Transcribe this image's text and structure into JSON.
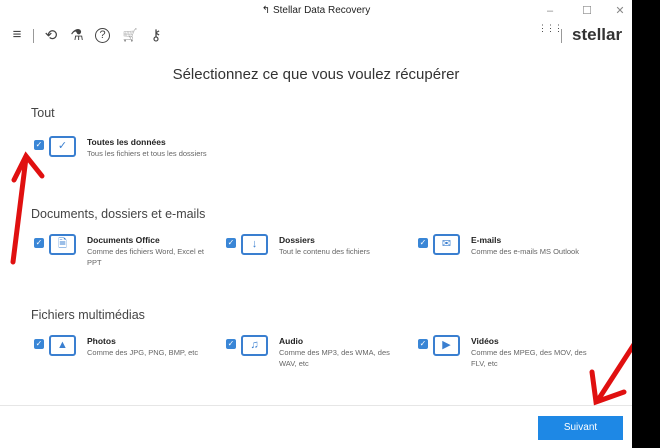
{
  "window": {
    "title": "Stellar Data Recovery",
    "minimize": "–",
    "maximize": "☐",
    "close": "✕"
  },
  "toolbar": {
    "menu": "≡",
    "history": "⟲",
    "lab": "⚗",
    "help": "?",
    "cart": "🛒",
    "key": "⚷",
    "apps": "⋮⋮⋮",
    "logo": "stellar"
  },
  "main": {
    "heading": "Sélectionnez ce que vous voulez récupérer",
    "sections": [
      {
        "title": "Tout",
        "items": [
          {
            "title": "Toutes les données",
            "desc": "Tous les fichiers et tous les dossiers",
            "icon": "✓",
            "checked": true
          }
        ]
      },
      {
        "title": "Documents, dossiers et e-mails",
        "items": [
          {
            "title": "Documents Office",
            "desc": "Comme des fichiers Word, Excel et PPT",
            "icon": "🗎",
            "checked": true
          },
          {
            "title": "Dossiers",
            "desc": "Tout le contenu des fichiers",
            "icon": "↓",
            "checked": true
          },
          {
            "title": "E-mails",
            "desc": "Comme des e-mails MS Outlook",
            "icon": "✉",
            "checked": true
          }
        ]
      },
      {
        "title": "Fichiers multimédias",
        "items": [
          {
            "title": "Photos",
            "desc": "Comme des JPG, PNG, BMP, etc",
            "icon": "▲",
            "checked": true
          },
          {
            "title": "Audio",
            "desc": "Comme des MP3, des WMA, des WAV, etc",
            "icon": "♫",
            "checked": true
          },
          {
            "title": "Vidéos",
            "desc": "Comme des MPEG, des MOV, des FLV, etc",
            "icon": "▶",
            "checked": true
          }
        ]
      }
    ]
  },
  "footer": {
    "next": "Suivant"
  },
  "colors": {
    "accent": "#1e88e5",
    "annotation": "#e01010"
  }
}
